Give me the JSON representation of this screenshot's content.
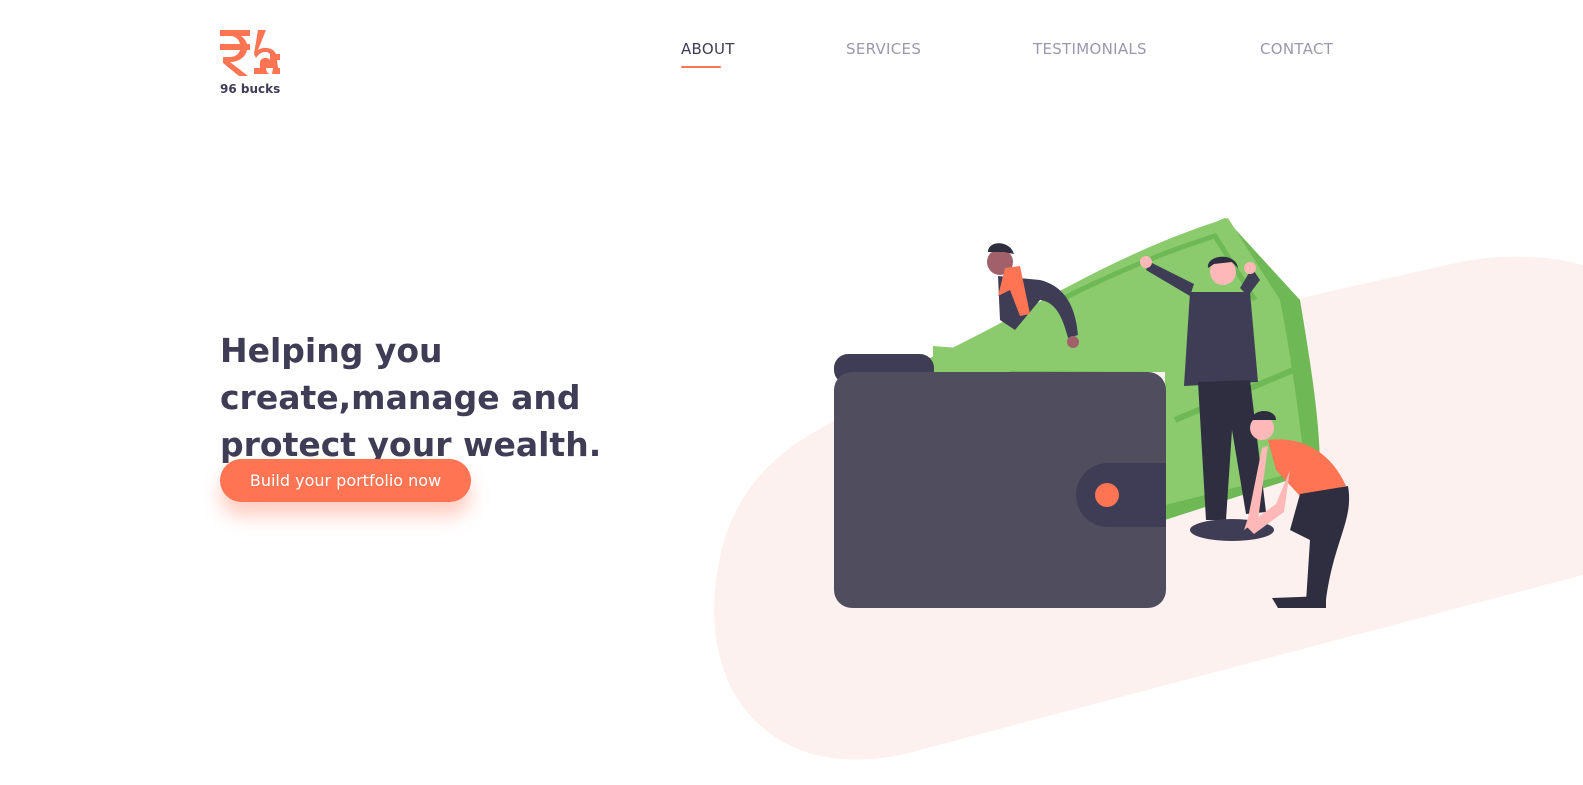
{
  "brand": {
    "name": "96 bucks",
    "logo_icon": "rupee-dollar-logo-icon"
  },
  "nav": {
    "items": [
      {
        "label": "ABOUT",
        "active": true
      },
      {
        "label": "SERVICES",
        "active": false
      },
      {
        "label": "TESTIMONIALS",
        "active": false
      },
      {
        "label": "CONTACT",
        "active": false
      }
    ]
  },
  "hero": {
    "title": "Helping you create,manage and protect your wealth.",
    "cta_label": "Build your portfolio now",
    "illustration_icon": "wallet-money-people-illustration"
  },
  "colors": {
    "accent": "#ff7452",
    "text_dark": "#3f3d56",
    "nav_inactive": "#9b98ad",
    "blob": "#fdf1ef",
    "money_green": "#8bcb6e",
    "wallet": "#4f4d5e"
  }
}
